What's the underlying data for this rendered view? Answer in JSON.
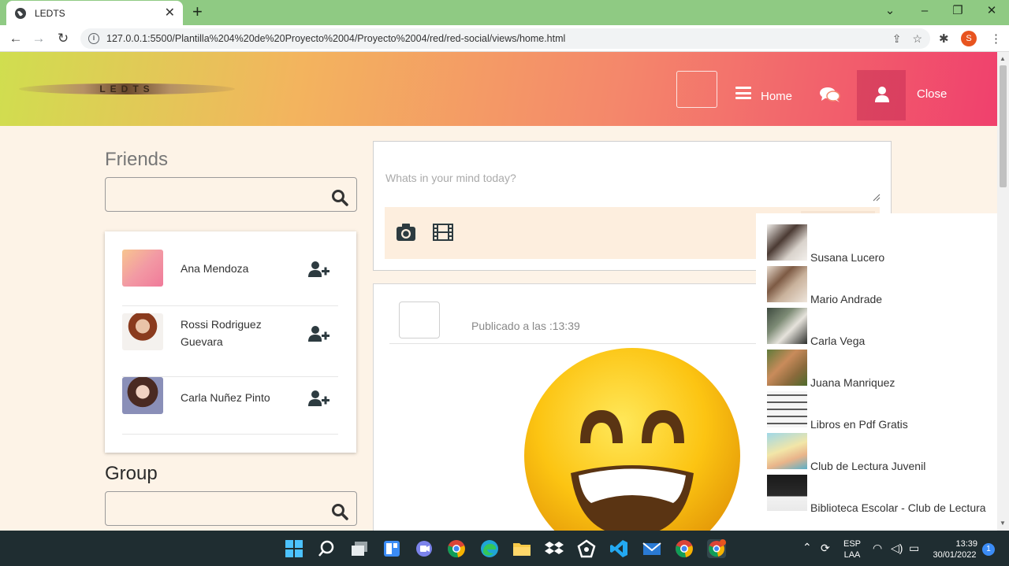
{
  "browser": {
    "tab_title": "LEDTS",
    "url": "127.0.0.1:5500/Plantilla%204%20de%20Proyecto%2004/Proyecto%2004/red/red-social/views/home.html",
    "profile_initial": "S"
  },
  "header": {
    "logo_text": "LEDTS",
    "home_label": "Home",
    "close_label": "Close"
  },
  "friends": {
    "title": "Friends",
    "items": [
      {
        "name": "Ana Mendoza"
      },
      {
        "name": "Rossi Rodriguez Guevara"
      },
      {
        "name": "Carla Nuñez Pinto"
      }
    ]
  },
  "groups": {
    "title": "Group"
  },
  "composer": {
    "placeholder": "Whats in your mind today?"
  },
  "post": {
    "time_text": "Publicado a las :13:39"
  },
  "suggestions": [
    {
      "name": "Susana Lucero"
    },
    {
      "name": "Mario Andrade"
    },
    {
      "name": "Carla Vega"
    },
    {
      "name": "Juana Manriquez"
    },
    {
      "name": "Libros en Pdf Gratis"
    },
    {
      "name": "Club de Lectura Juvenil"
    },
    {
      "name": "Biblioteca Escolar - Club de Lectura"
    }
  ],
  "taskbar": {
    "lang_top": "ESP",
    "lang_bottom": "LAA",
    "time": "13:39",
    "date": "30/01/2022",
    "notification_count": "1"
  },
  "colors": {
    "header_gradient": [
      "#d0de4f",
      "#f3b45e",
      "#f4876b",
      "#f0406d"
    ],
    "page_background": "#fdf3e7",
    "taskbar": "#1f2d31"
  }
}
